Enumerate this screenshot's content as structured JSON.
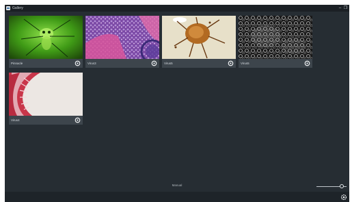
{
  "app": {
    "title": "Gallery",
    "icon": "app-image-icon",
    "min_glyph": "–",
    "restore_glyph": "❐"
  },
  "cards": [
    {
      "caption": "Pinnacle",
      "image": "green-insect-micrograph",
      "icon": "settings-icon"
    },
    {
      "caption": "Virus3",
      "image": "purple-tissue-micrograph",
      "icon": "settings-icon"
    },
    {
      "caption": "Virus5",
      "image": "mite-specimen-micrograph",
      "icon": "settings-icon"
    },
    {
      "caption": "Virus5",
      "image": "grayscale-cell-micrograph",
      "icon": "settings-icon"
    },
    {
      "caption": "Virus4",
      "image": "red-tissue-cross-section",
      "icon": "settings-icon"
    }
  ],
  "footer": {
    "label": "Manual",
    "zoom_level": 0.9
  },
  "bottombar": {
    "icon": "settings-icon"
  },
  "colors": {
    "window_bg": "#262d33",
    "card_bg": "#3d454c",
    "titlebar_bg": "#1b2025"
  }
}
